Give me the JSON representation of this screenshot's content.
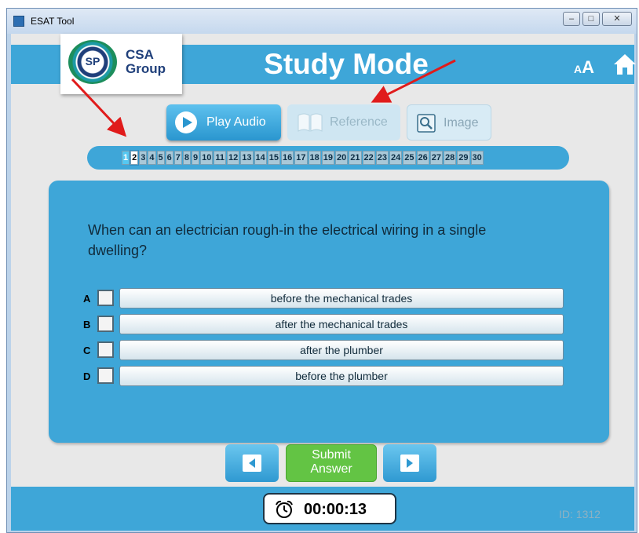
{
  "window": {
    "title": "ESAT Tool",
    "controls": [
      "–",
      "□",
      "✕"
    ]
  },
  "header": {
    "title": "Study Mode",
    "font_size_small": "A",
    "font_size_large": "A"
  },
  "logo": {
    "line1": "CSA",
    "line2": "Group",
    "emblem": "SP"
  },
  "toolbar": {
    "play_audio": "Play Audio",
    "reference": "Reference",
    "image": "Image"
  },
  "question_numbers": [
    "1",
    "2",
    "3",
    "4",
    "5",
    "6",
    "7",
    "8",
    "9",
    "10",
    "11",
    "12",
    "13",
    "14",
    "15",
    "16",
    "17",
    "18",
    "19",
    "20",
    "21",
    "22",
    "23",
    "24",
    "25",
    "26",
    "27",
    "28",
    "29",
    "30"
  ],
  "current_question": "2",
  "question": {
    "text": "When can an electrician rough-in the electrical wiring in a single dwelling?",
    "options": [
      {
        "letter": "A",
        "text": "before the mechanical trades"
      },
      {
        "letter": "B",
        "text": "after the mechanical trades"
      },
      {
        "letter": "C",
        "text": "after the plumber"
      },
      {
        "letter": "D",
        "text": "before the plumber"
      }
    ]
  },
  "nav": {
    "submit_line1": "Submit",
    "submit_line2": "Answer"
  },
  "footer": {
    "timer": "00:00:13",
    "id_text": "ID: 1312"
  },
  "colors": {
    "brand_blue": "#3ea6d8",
    "submit_green": "#63c444",
    "annotation_red": "#e01b1b"
  },
  "icons": {
    "play": "play-circle-icon",
    "reference": "book-icon",
    "image": "magnifier-icon",
    "home": "home-icon",
    "prev": "left-triangle-icon",
    "next": "right-triangle-icon",
    "timer": "alarm-clock-icon"
  }
}
